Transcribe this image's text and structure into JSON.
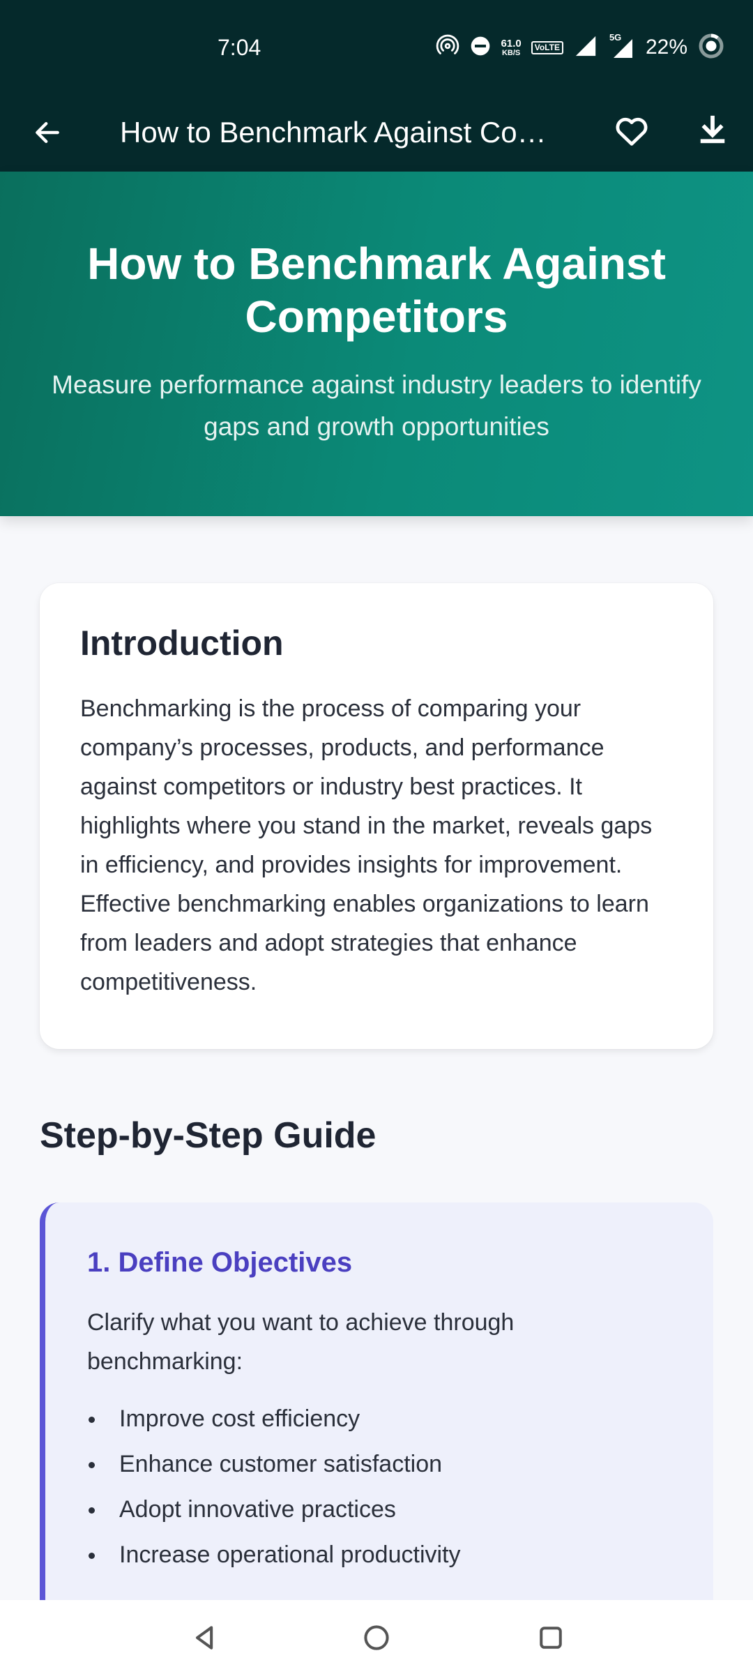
{
  "status_bar": {
    "time": "7:04",
    "net_speed_value": "61.0",
    "net_speed_unit": "KB/S",
    "volte_label": "VoLTE",
    "network_label": "5G",
    "battery": "22%"
  },
  "app_bar": {
    "title": "How to Benchmark Against Co…"
  },
  "hero": {
    "title": "How to Benchmark Against Competitors",
    "subtitle": "Measure performance against industry leaders to identify gaps and growth opportunities"
  },
  "intro": {
    "title": "Introduction",
    "body": "Benchmarking is the process of comparing your company’s processes, products, and performance against competitors or industry best practices. It highlights where you stand in the market, reveals gaps in efficiency, and provides insights for improvement. Effective benchmarking enables organizations to learn from leaders and adopt strategies that enhance competitiveness."
  },
  "guide": {
    "title": "Step-by-Step Guide",
    "steps": [
      {
        "title": "1. Define Objectives",
        "desc": "Clarify what you want to achieve through benchmarking:",
        "items": [
          "Improve cost efficiency",
          "Enhance customer satisfaction",
          "Adopt innovative practices",
          "Increase operational productivity"
        ]
      }
    ]
  },
  "colors": {
    "topbar": "#05292b",
    "hero_start": "#0a6f5d",
    "hero_end": "#0e9384",
    "step_accent": "#5b55d6",
    "step_title": "#4a3fc0",
    "step_bg": "#eef0fb"
  }
}
